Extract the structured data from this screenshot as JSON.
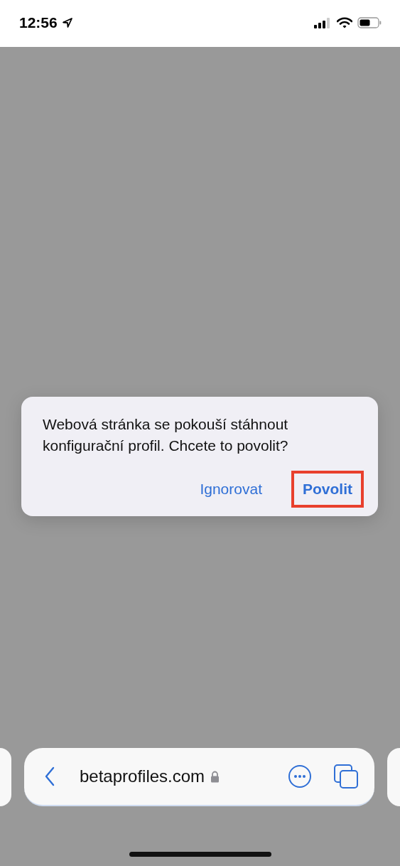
{
  "status_bar": {
    "time": "12:56"
  },
  "dialog": {
    "message": "Webová stránka se pokouší stáhnout konfigurační profil. Chcete to povolit?",
    "buttons": [
      {
        "label": "Ignorovat",
        "kind": "default",
        "highlighted": false
      },
      {
        "label": "Povolit",
        "kind": "preferred",
        "highlighted": true
      }
    ]
  },
  "address_bar": {
    "url": "betaprofiles.com"
  }
}
